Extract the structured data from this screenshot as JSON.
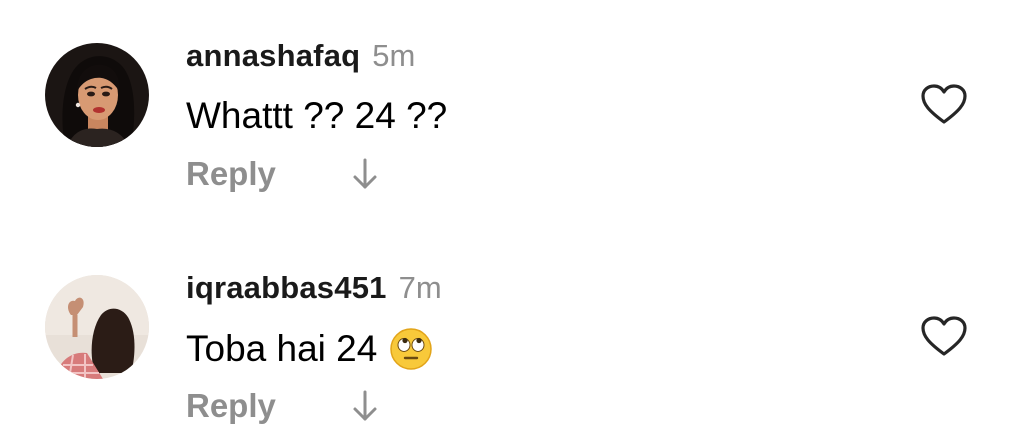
{
  "comments": [
    {
      "username": "annashafaq",
      "time": "5m",
      "text": "Whattt ?? 24 ??",
      "emoji": "",
      "reply_label": "Reply",
      "avatar_icon": "woman-avatar-illustration",
      "like_icon": "heart-outline-icon",
      "expand_icon": "arrow-down-icon"
    },
    {
      "username": "iqraabbas451",
      "time": "7m",
      "text": "Toba hai 24",
      "emoji": "eye-roll-emoji",
      "reply_label": "Reply",
      "avatar_icon": "photo-avatar-heart-hands",
      "like_icon": "heart-outline-icon",
      "expand_icon": "arrow-down-icon"
    }
  ],
  "colors": {
    "username": "#1a1a1a",
    "secondary": "#8e8e8e",
    "text": "#000000",
    "background": "#ffffff"
  }
}
